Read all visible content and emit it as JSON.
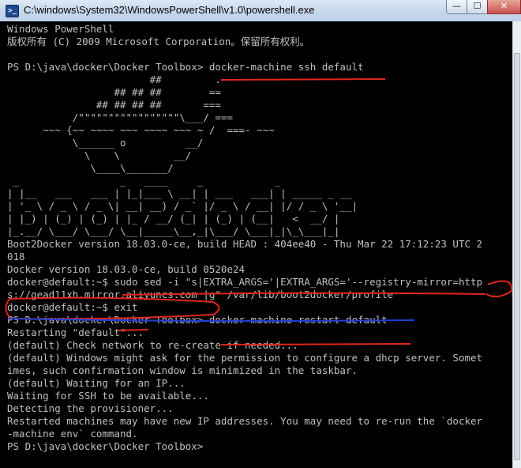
{
  "window": {
    "title": "C:\\windows\\System32\\WindowsPowerShell\\v1.0\\powershell.exe",
    "app_icon": "powershell-icon",
    "controls": {
      "minimize": "—",
      "maximize": "☐",
      "close": "✕"
    }
  },
  "console": {
    "text_color": "#c0c0c0",
    "background": "#000000",
    "lines": [
      "Windows PowerShell",
      "版权所有 (C) 2009 Microsoft Corporation。保留所有权利。",
      "",
      "PS D:\\java\\docker\\Docker Toolbox> docker-machine ssh default",
      "                        ##         .",
      "                  ## ## ##        ==",
      "               ## ## ## ##       ===",
      "           /\"\"\"\"\"\"\"\"\"\"\"\"\"\"\"\"\"\\___/ ===",
      "      ~~~ {~~ ~~~~ ~~~ ~~~~ ~~~ ~ /  ===- ~~~",
      "           \\______ o          __/",
      "             \\    \\         __/",
      "              \\____\\_______/",
      " _                 _   ____     _            _",
      "| |__   ___   ___ | |_|___ \\ __| | ___   ___| | _____ _ __",
      "| '_ \\ / _ \\ / _ \\| __| __) / _` |/ _ \\ / __| |/ / _ \\ '__|",
      "| |_) | (_) | (_) | |_ / __/ (_| | (_) | (__|   <  __/ |",
      "|_.__/ \\___/ \\___/ \\__|_____\\__,_|\\___/ \\___|_|\\_\\___|_|",
      "Boot2Docker version 18.03.0-ce, build HEAD : 404ee40 - Thu Mar 22 17:12:23 UTC 2",
      "018",
      "Docker version 18.03.0-ce, build 0520e24",
      "docker@default:~$ sudo sed -i \"s|EXTRA_ARGS='|EXTRA_ARGS='--registry-mirror=http",
      "s://gead11xh.mirror.aliyuncs.com |g\" /var/lib/boot2docker/profile",
      "docker@default:~$ exit",
      "PS D:\\java\\docker\\Docker Toolbox> docker-machine restart default",
      "Restarting \"default\"...",
      "(default) Check network to re-create if needed...",
      "(default) Windows might ask for the permission to configure a dhcp server. Somet",
      "imes, such confirmation window is minimized in the taskbar.",
      "(default) Waiting for an IP...",
      "Waiting for SSH to be available...",
      "Detecting the provisioner...",
      "Restarted machines may have new IP addresses. You may need to re-run the `docker",
      "-machine env` command.",
      "PS D:\\java\\docker\\Docker Toolbox>"
    ]
  },
  "annotations": {
    "colors": {
      "red": "#e0261e",
      "blue": "#1f3fd6"
    }
  }
}
